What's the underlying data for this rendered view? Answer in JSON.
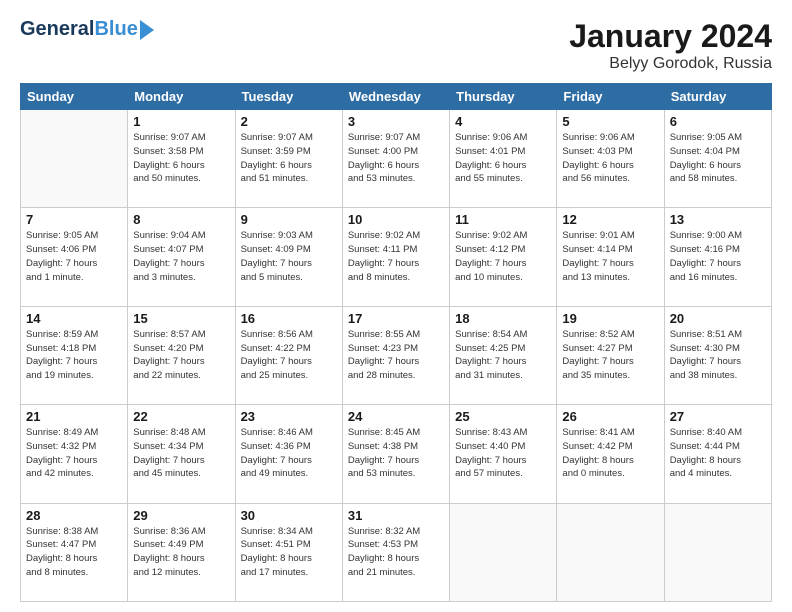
{
  "header": {
    "logo_general": "General",
    "logo_blue": "Blue",
    "title": "January 2024",
    "subtitle": "Belyy Gorodok, Russia"
  },
  "days_of_week": [
    "Sunday",
    "Monday",
    "Tuesday",
    "Wednesday",
    "Thursday",
    "Friday",
    "Saturday"
  ],
  "weeks": [
    [
      {
        "day": "",
        "info": ""
      },
      {
        "day": "1",
        "info": "Sunrise: 9:07 AM\nSunset: 3:58 PM\nDaylight: 6 hours\nand 50 minutes."
      },
      {
        "day": "2",
        "info": "Sunrise: 9:07 AM\nSunset: 3:59 PM\nDaylight: 6 hours\nand 51 minutes."
      },
      {
        "day": "3",
        "info": "Sunrise: 9:07 AM\nSunset: 4:00 PM\nDaylight: 6 hours\nand 53 minutes."
      },
      {
        "day": "4",
        "info": "Sunrise: 9:06 AM\nSunset: 4:01 PM\nDaylight: 6 hours\nand 55 minutes."
      },
      {
        "day": "5",
        "info": "Sunrise: 9:06 AM\nSunset: 4:03 PM\nDaylight: 6 hours\nand 56 minutes."
      },
      {
        "day": "6",
        "info": "Sunrise: 9:05 AM\nSunset: 4:04 PM\nDaylight: 6 hours\nand 58 minutes."
      }
    ],
    [
      {
        "day": "7",
        "info": "Sunrise: 9:05 AM\nSunset: 4:06 PM\nDaylight: 7 hours\nand 1 minute."
      },
      {
        "day": "8",
        "info": "Sunrise: 9:04 AM\nSunset: 4:07 PM\nDaylight: 7 hours\nand 3 minutes."
      },
      {
        "day": "9",
        "info": "Sunrise: 9:03 AM\nSunset: 4:09 PM\nDaylight: 7 hours\nand 5 minutes."
      },
      {
        "day": "10",
        "info": "Sunrise: 9:02 AM\nSunset: 4:11 PM\nDaylight: 7 hours\nand 8 minutes."
      },
      {
        "day": "11",
        "info": "Sunrise: 9:02 AM\nSunset: 4:12 PM\nDaylight: 7 hours\nand 10 minutes."
      },
      {
        "day": "12",
        "info": "Sunrise: 9:01 AM\nSunset: 4:14 PM\nDaylight: 7 hours\nand 13 minutes."
      },
      {
        "day": "13",
        "info": "Sunrise: 9:00 AM\nSunset: 4:16 PM\nDaylight: 7 hours\nand 16 minutes."
      }
    ],
    [
      {
        "day": "14",
        "info": "Sunrise: 8:59 AM\nSunset: 4:18 PM\nDaylight: 7 hours\nand 19 minutes."
      },
      {
        "day": "15",
        "info": "Sunrise: 8:57 AM\nSunset: 4:20 PM\nDaylight: 7 hours\nand 22 minutes."
      },
      {
        "day": "16",
        "info": "Sunrise: 8:56 AM\nSunset: 4:22 PM\nDaylight: 7 hours\nand 25 minutes."
      },
      {
        "day": "17",
        "info": "Sunrise: 8:55 AM\nSunset: 4:23 PM\nDaylight: 7 hours\nand 28 minutes."
      },
      {
        "day": "18",
        "info": "Sunrise: 8:54 AM\nSunset: 4:25 PM\nDaylight: 7 hours\nand 31 minutes."
      },
      {
        "day": "19",
        "info": "Sunrise: 8:52 AM\nSunset: 4:27 PM\nDaylight: 7 hours\nand 35 minutes."
      },
      {
        "day": "20",
        "info": "Sunrise: 8:51 AM\nSunset: 4:30 PM\nDaylight: 7 hours\nand 38 minutes."
      }
    ],
    [
      {
        "day": "21",
        "info": "Sunrise: 8:49 AM\nSunset: 4:32 PM\nDaylight: 7 hours\nand 42 minutes."
      },
      {
        "day": "22",
        "info": "Sunrise: 8:48 AM\nSunset: 4:34 PM\nDaylight: 7 hours\nand 45 minutes."
      },
      {
        "day": "23",
        "info": "Sunrise: 8:46 AM\nSunset: 4:36 PM\nDaylight: 7 hours\nand 49 minutes."
      },
      {
        "day": "24",
        "info": "Sunrise: 8:45 AM\nSunset: 4:38 PM\nDaylight: 7 hours\nand 53 minutes."
      },
      {
        "day": "25",
        "info": "Sunrise: 8:43 AM\nSunset: 4:40 PM\nDaylight: 7 hours\nand 57 minutes."
      },
      {
        "day": "26",
        "info": "Sunrise: 8:41 AM\nSunset: 4:42 PM\nDaylight: 8 hours\nand 0 minutes."
      },
      {
        "day": "27",
        "info": "Sunrise: 8:40 AM\nSunset: 4:44 PM\nDaylight: 8 hours\nand 4 minutes."
      }
    ],
    [
      {
        "day": "28",
        "info": "Sunrise: 8:38 AM\nSunset: 4:47 PM\nDaylight: 8 hours\nand 8 minutes."
      },
      {
        "day": "29",
        "info": "Sunrise: 8:36 AM\nSunset: 4:49 PM\nDaylight: 8 hours\nand 12 minutes."
      },
      {
        "day": "30",
        "info": "Sunrise: 8:34 AM\nSunset: 4:51 PM\nDaylight: 8 hours\nand 17 minutes."
      },
      {
        "day": "31",
        "info": "Sunrise: 8:32 AM\nSunset: 4:53 PM\nDaylight: 8 hours\nand 21 minutes."
      },
      {
        "day": "",
        "info": ""
      },
      {
        "day": "",
        "info": ""
      },
      {
        "day": "",
        "info": ""
      }
    ]
  ]
}
